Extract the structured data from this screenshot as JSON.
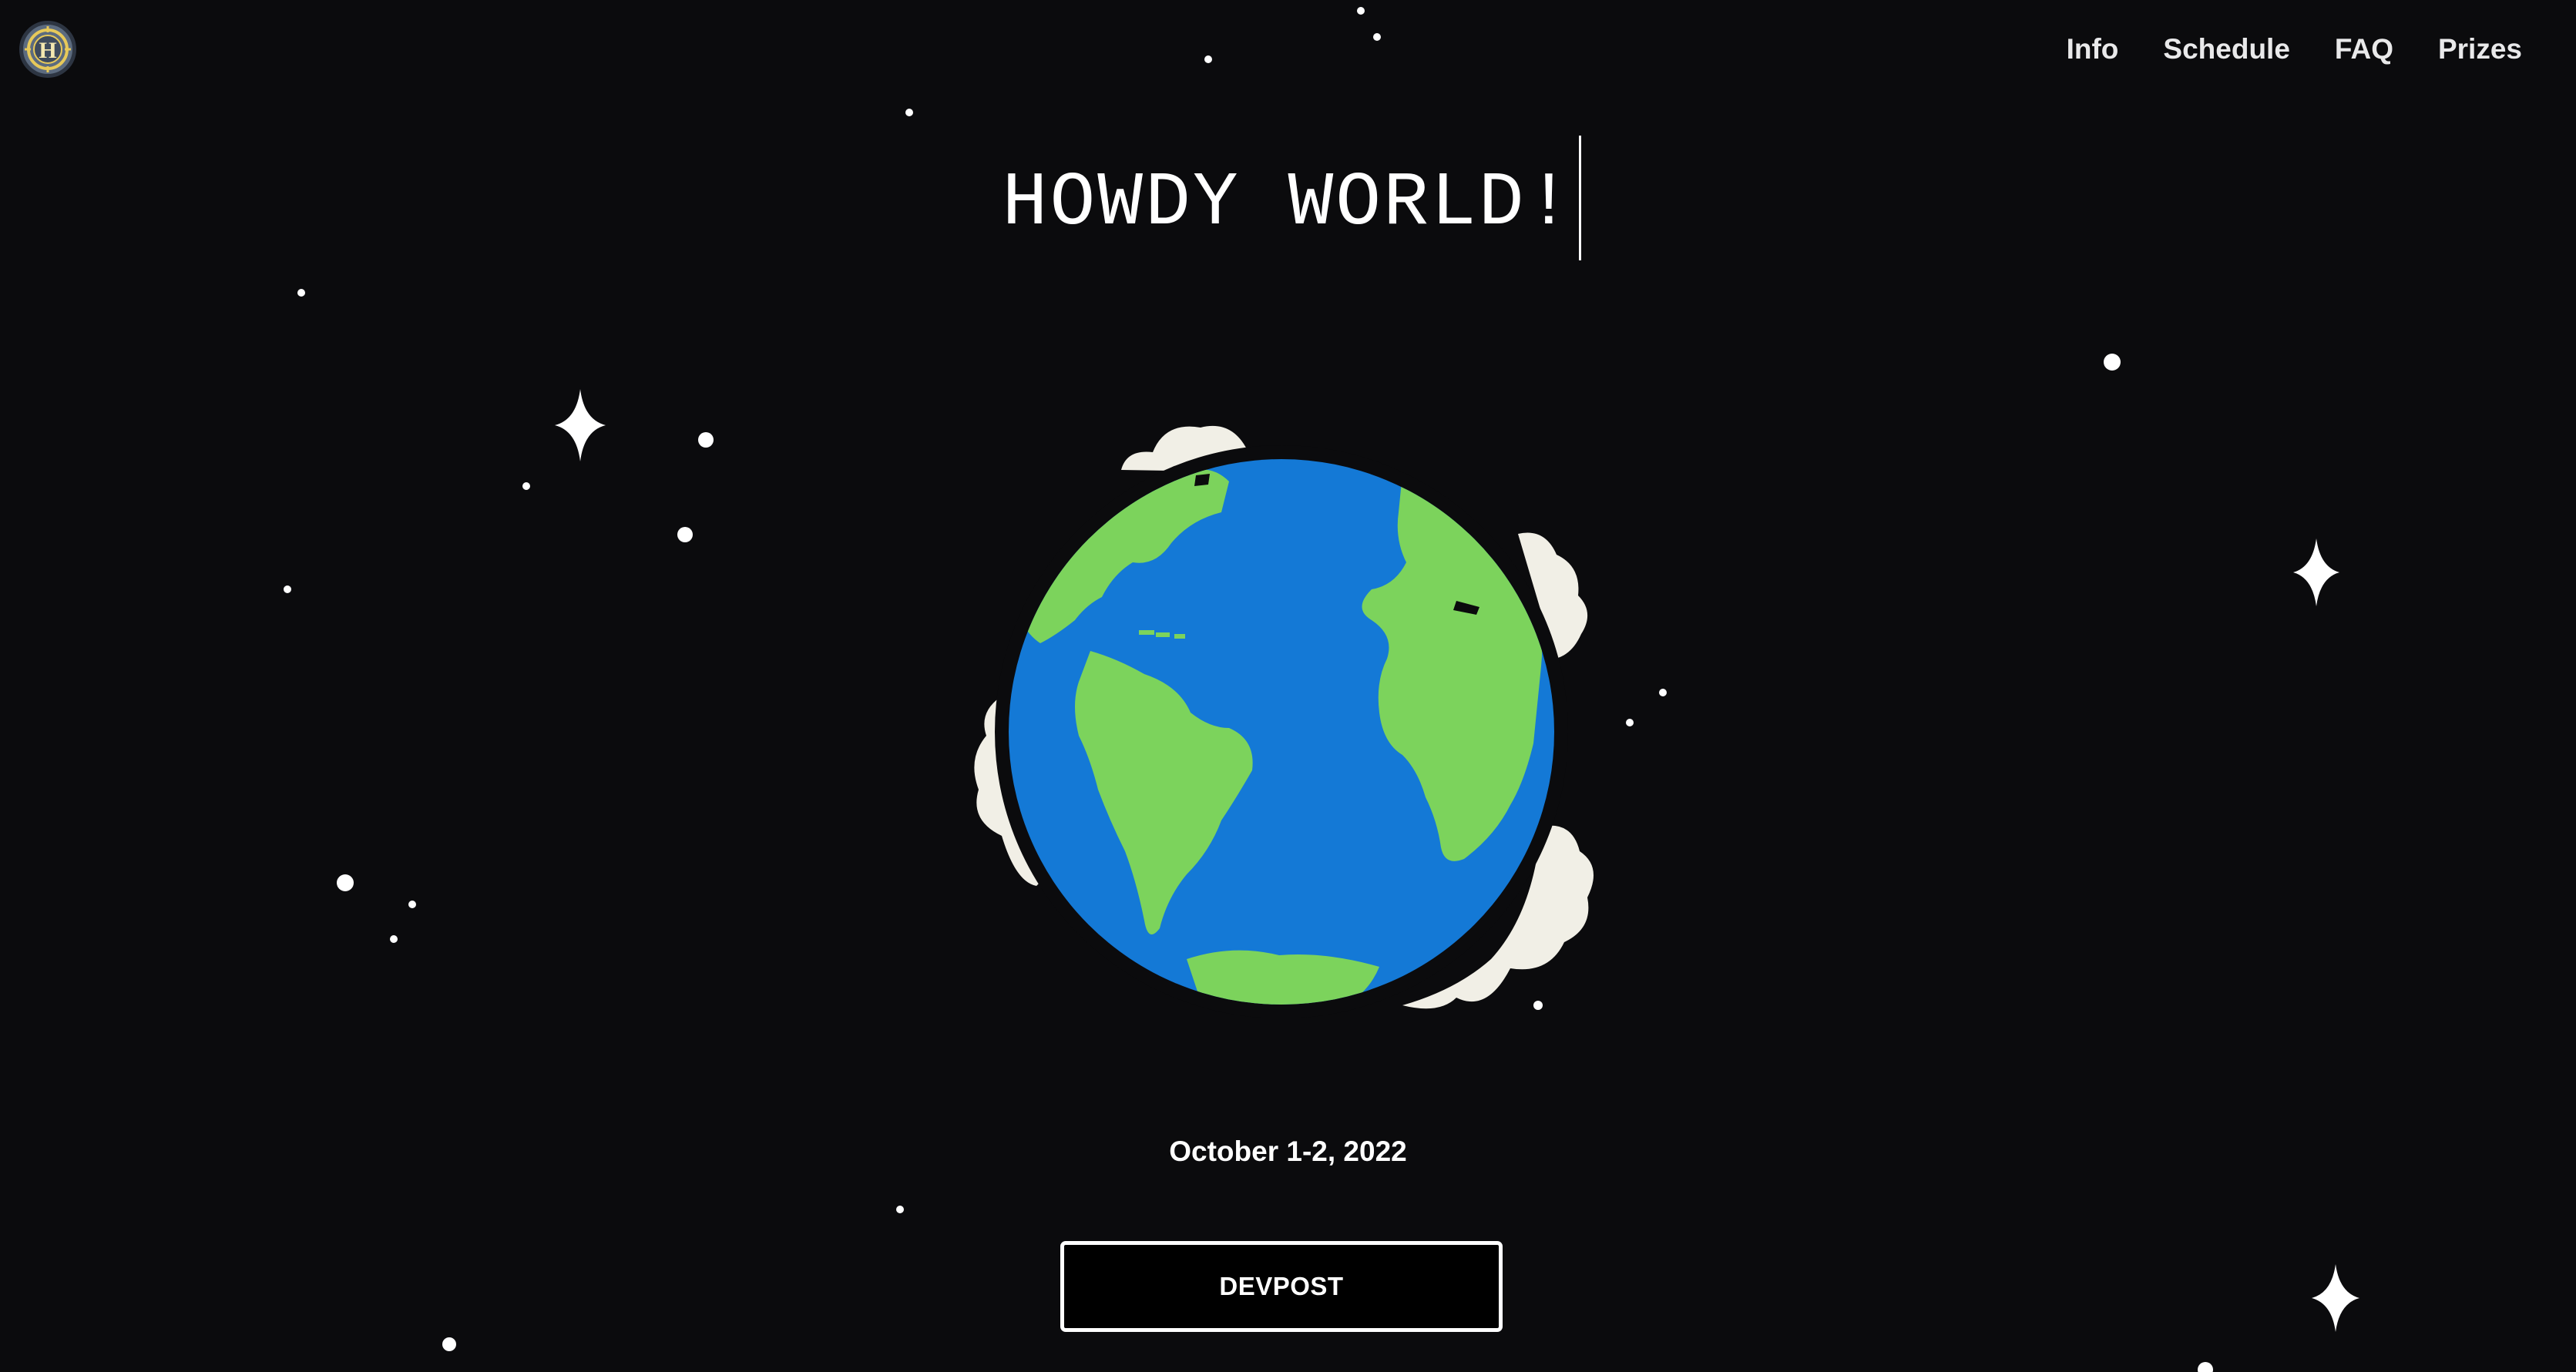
{
  "header": {
    "logo_letter": "H",
    "nav": [
      {
        "label": "Info"
      },
      {
        "label": "Schedule"
      },
      {
        "label": "FAQ"
      },
      {
        "label": "Prizes"
      }
    ]
  },
  "hero": {
    "title": "HOWDY WORLD!",
    "date": "October 1-2, 2022",
    "cta_label": "DEVPOST"
  },
  "colors": {
    "background": "#0b0b0d",
    "ocean": "#1479d6",
    "land": "#7cd35c",
    "cloud": "#f1efe6",
    "text": "#ffffff"
  }
}
